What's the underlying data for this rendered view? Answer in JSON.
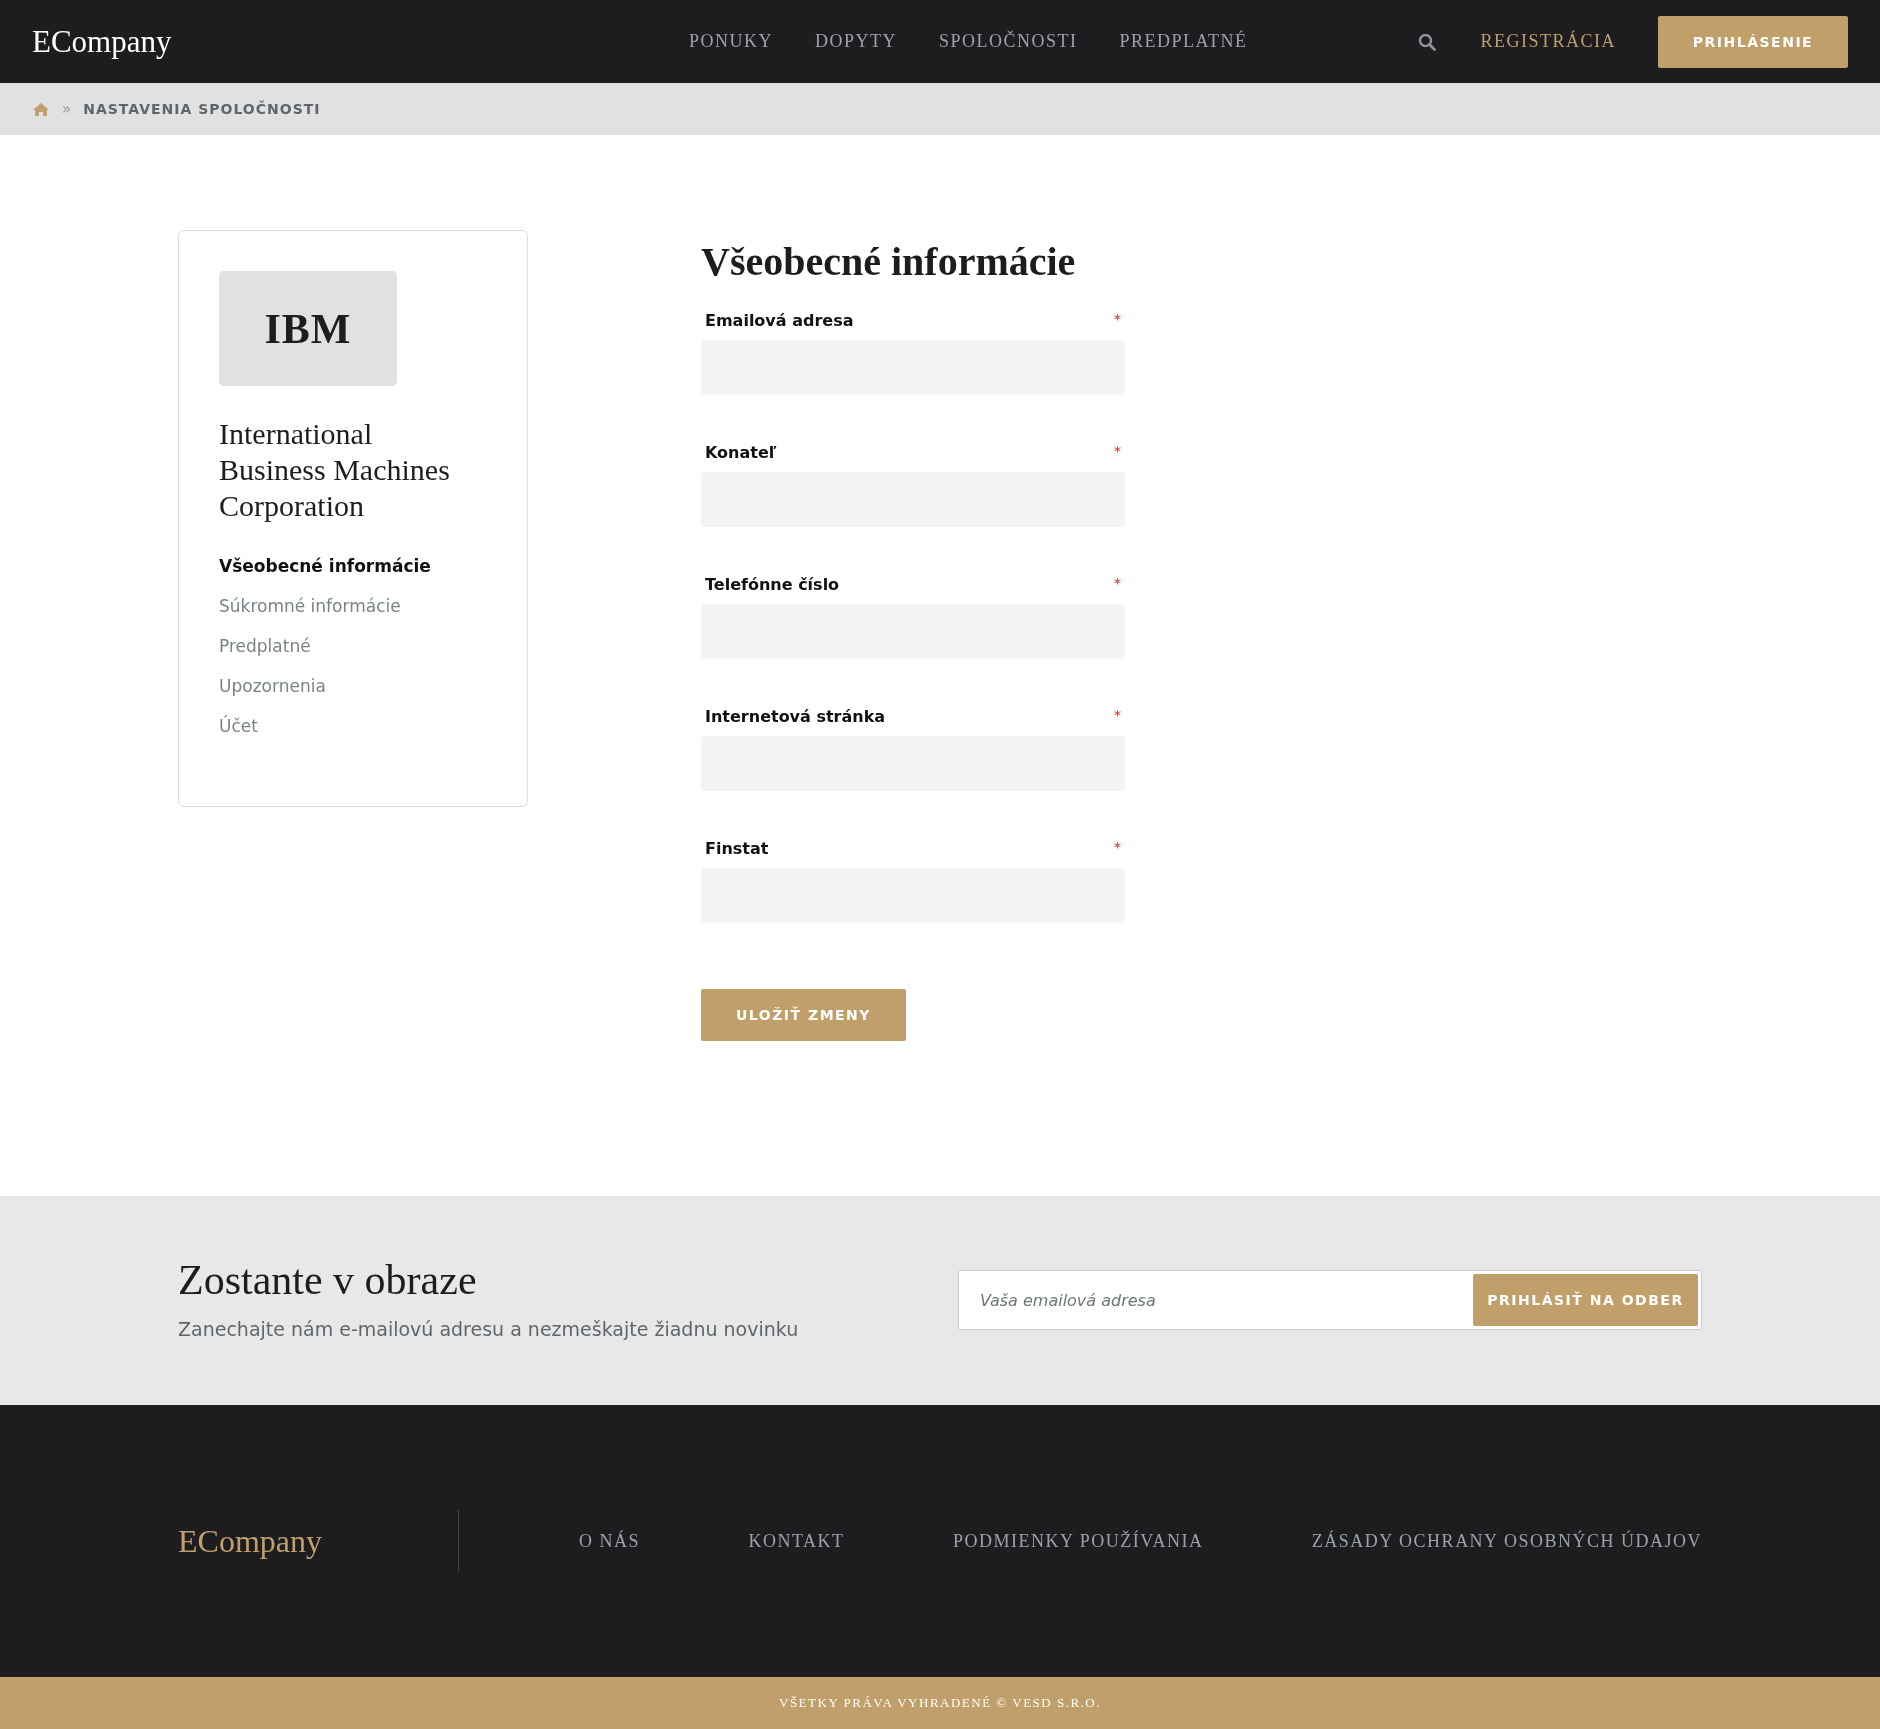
{
  "header": {
    "logo": "ECompany",
    "nav": [
      {
        "label": "PONUKY",
        "selected": false
      },
      {
        "label": "DOPYTY",
        "selected": false
      },
      {
        "label": "SPOLOČNOSTI",
        "selected": false
      },
      {
        "label": "PREDPLATNÉ",
        "selected": false
      }
    ],
    "register": "REGISTRÁCIA",
    "login": "PRIHLÁSENIE"
  },
  "breadcrumb": {
    "separator": "»",
    "current": "NASTAVENIA SPOLOČNOSTI"
  },
  "sidebar": {
    "logo_text": "IBM",
    "company": "International Business Machines Corporation",
    "items": [
      {
        "label": "Všeobecné informácie",
        "selected": true
      },
      {
        "label": "Súkromné informácie",
        "selected": false
      },
      {
        "label": "Predplatné",
        "selected": false
      },
      {
        "label": "Upozornenia",
        "selected": false
      },
      {
        "label": "Účet",
        "selected": false
      }
    ]
  },
  "form": {
    "title": "Všeobecné informácie",
    "fields": [
      {
        "label": "Emailová adresa",
        "required": true
      },
      {
        "label": "Konateľ",
        "required": true
      },
      {
        "label": "Telefónne číslo",
        "required": true
      },
      {
        "label": "Internetová stránka",
        "required": true
      },
      {
        "label": "Finstat",
        "required": true
      }
    ],
    "required_mark": "*",
    "save": "ULOŽIŤ ZMENY"
  },
  "newsletter": {
    "title": "Zostante v obraze",
    "text": "Zanechajte nám e-mailovú adresu a nezmeškajte žiadnu novinku",
    "placeholder": "Vaša emailová adresa",
    "button": "PRIHLÁSIŤ NA ODBER"
  },
  "footer": {
    "logo": "ECompany",
    "links": [
      "O NÁS",
      "KONTAKT",
      "PODMIENKY POUŽÍVANIA",
      "ZÁSADY OCHRANY OSOBNÝCH ÚDAJOV"
    ],
    "copyright": "VŠETKY PRÁVA VYHRADENÉ © VESD S.R.O."
  }
}
